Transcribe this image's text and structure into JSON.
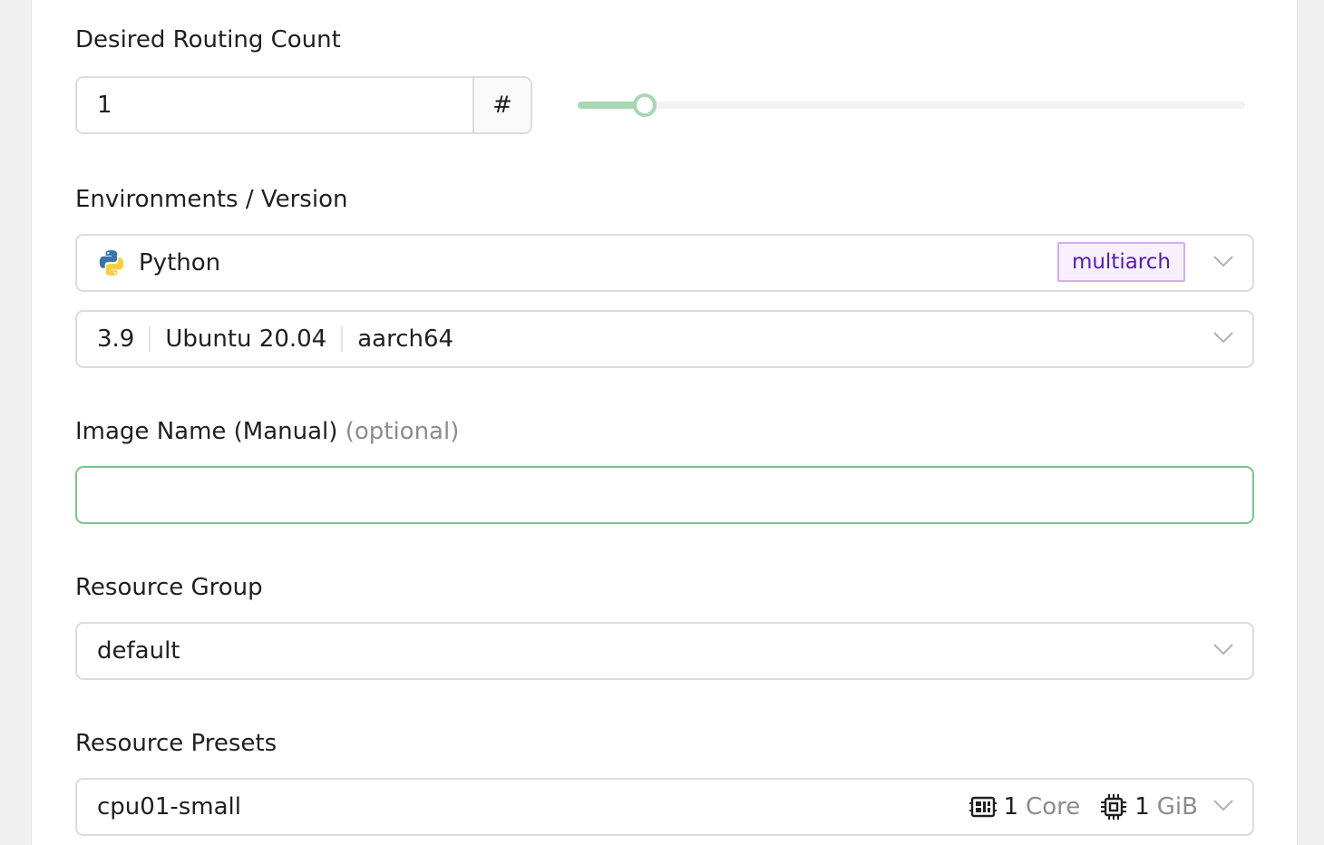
{
  "routing": {
    "label": "Desired Routing Count",
    "value": "1",
    "addon": "#",
    "slider_fraction": 0.1
  },
  "environment": {
    "label": "Environments / Version",
    "image": "Python",
    "image_icon": "python-icon",
    "tag": "multiarch",
    "version": "3.9",
    "os": "Ubuntu 20.04",
    "arch": "aarch64"
  },
  "image_name": {
    "label": "Image Name (Manual)",
    "optional": "(optional)",
    "value": ""
  },
  "resource_group": {
    "label": "Resource Group",
    "value": "default"
  },
  "resource_presets": {
    "label": "Resource Presets",
    "value": "cpu01-small",
    "cpu_value": "1",
    "cpu_unit": "Core",
    "mem_value": "1",
    "mem_unit": "GiB"
  },
  "colors": {
    "accent": "#a7d6b3",
    "focus_border": "#7ec28f",
    "tag_text": "#531dab",
    "tag_bg": "#f9f0ff",
    "tag_border": "#d3adf7"
  }
}
